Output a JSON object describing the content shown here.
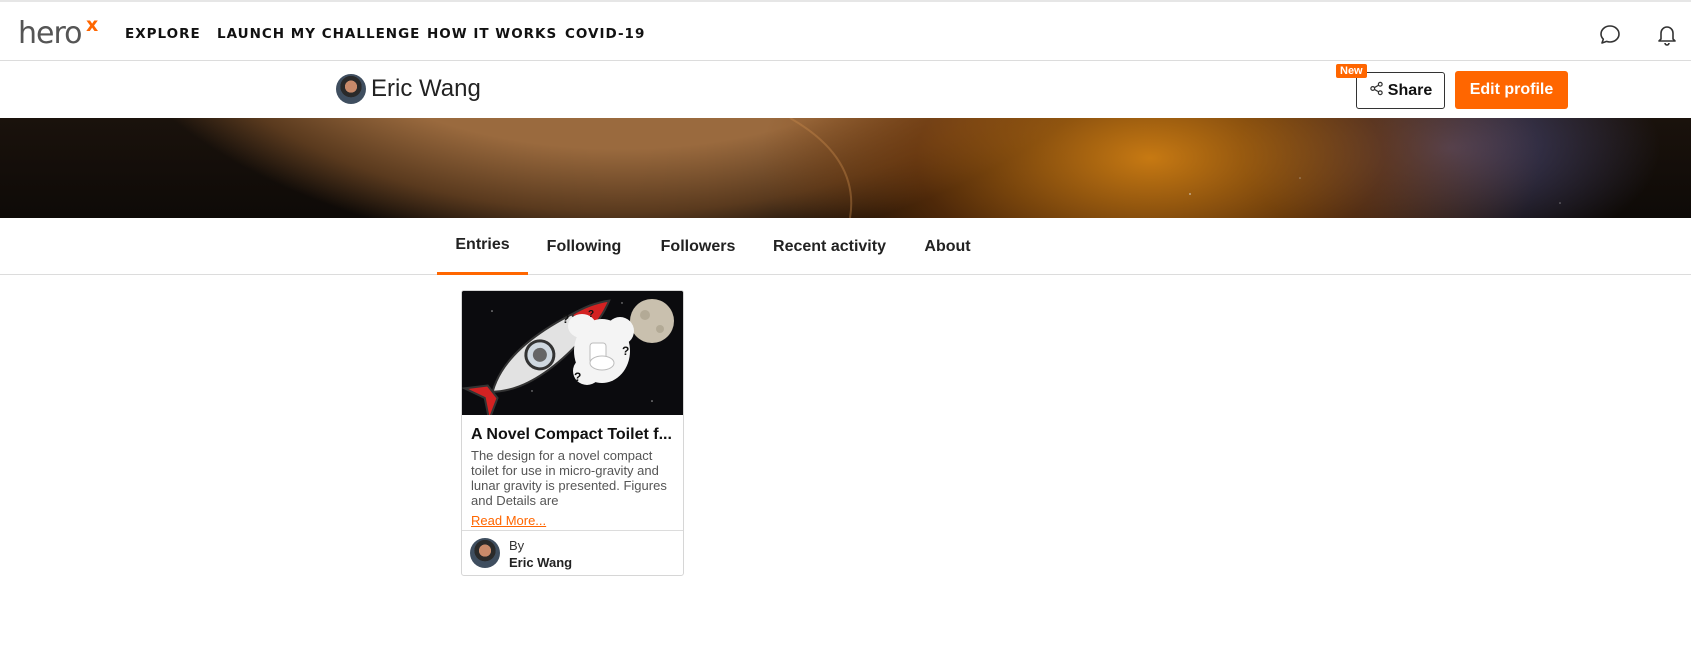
{
  "brand": {
    "logo_text": "hero",
    "logo_mark": "x",
    "accent_color": "#ff6600"
  },
  "nav": {
    "items": [
      {
        "label": "EXPLORE"
      },
      {
        "label": "LAUNCH MY CHALLENGE"
      },
      {
        "label": "HOW IT WORKS"
      },
      {
        "label": "COVID-19"
      }
    ],
    "icons": [
      "chat-bubble-icon",
      "bell-icon"
    ]
  },
  "profile": {
    "name": "Eric Wang",
    "share_label": "Share",
    "share_badge": "New",
    "edit_label": "Edit profile"
  },
  "tabs": [
    {
      "label": "Entries",
      "active": true
    },
    {
      "label": "Following",
      "active": false
    },
    {
      "label": "Followers",
      "active": false
    },
    {
      "label": "Recent activity",
      "active": false
    },
    {
      "label": "About",
      "active": false
    }
  ],
  "entries": [
    {
      "title": "A Novel Compact Toilet f...",
      "description": "The design for a novel compact toilet for use in micro-gravity and lunar gravity is presented. Figures and Details are",
      "read_more": "Read More...",
      "by_label": "By",
      "author": "Eric Wang"
    }
  ]
}
